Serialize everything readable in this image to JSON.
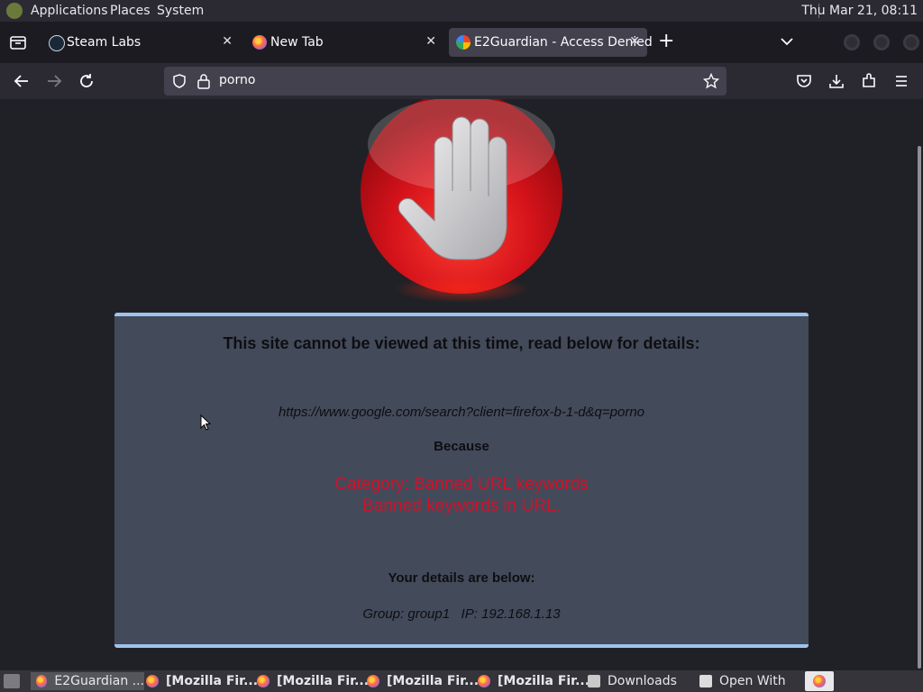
{
  "system_panel": {
    "menus": [
      "Applications",
      "Places",
      "System"
    ],
    "clock": "Thu Mar 21, 08:11"
  },
  "tabs": [
    {
      "title": "Steam Labs",
      "icon": "steam-icon"
    },
    {
      "title": "New Tab",
      "icon": "firefox-icon"
    },
    {
      "title": "E2Guardian - Access Denied",
      "icon": "google-icon",
      "active": true
    }
  ],
  "url_bar": {
    "value": "porno"
  },
  "page": {
    "heading": "This site cannot be viewed at this time, read below for details:",
    "blocked_url": "https://www.google.com/search?client=firefox-b-1-d&q=porno",
    "because_label": "Because",
    "reason_line1": "Category: Banned URL keywords",
    "reason_line2": "Banned keywords in URL.",
    "details_label": "Your details are below:",
    "details": "Group: group1   IP: 192.168.1.13"
  },
  "taskbar": {
    "items": [
      "E2Guardian ...",
      "[Mozilla Fir...",
      "[Mozilla Fir...",
      "[Mozilla Fir...",
      "[Mozilla Fir...",
      "Downloads",
      "Open With"
    ]
  },
  "colors": {
    "accent": "#9fc3ee",
    "reason_red": "#d0122a",
    "panel": "#434a5a"
  }
}
